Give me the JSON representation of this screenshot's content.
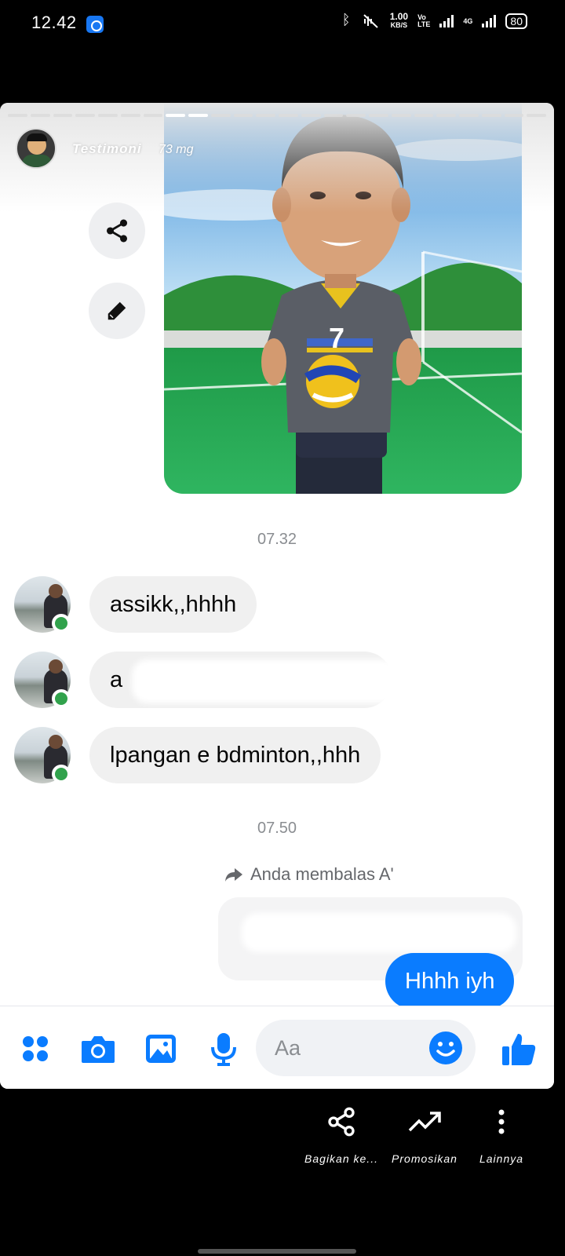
{
  "status_bar": {
    "time": "12.42",
    "net_speed_value": "1.00",
    "net_speed_unit": "KB/S",
    "volte_top": "Vo",
    "volte_bottom": "LTE",
    "network_type": "4G",
    "battery": "80"
  },
  "story": {
    "author": "Testimoni",
    "age": "73 mg",
    "progress_segments": 24,
    "active_segments": [
      7,
      8
    ]
  },
  "conversation": {
    "timestamp_1": "07.32",
    "messages_incoming": [
      {
        "text": "assikk,,hhhh"
      },
      {
        "text": "a"
      },
      {
        "text": "lpangan e bdminton,,hhh"
      }
    ],
    "timestamp_2": "07.50",
    "reply_label": "Anda membalas A'",
    "outgoing_message": "Hhhh iyh"
  },
  "composer": {
    "placeholder": "Aa",
    "icons": [
      "menu-icon",
      "camera-icon",
      "gallery-icon",
      "microphone-icon",
      "emoji-icon",
      "like-icon"
    ],
    "accent_color": "#0a7cff"
  },
  "actions": [
    {
      "label": "Bagikan ke..."
    },
    {
      "label": "Promosikan"
    },
    {
      "label": "Lainnya"
    }
  ]
}
